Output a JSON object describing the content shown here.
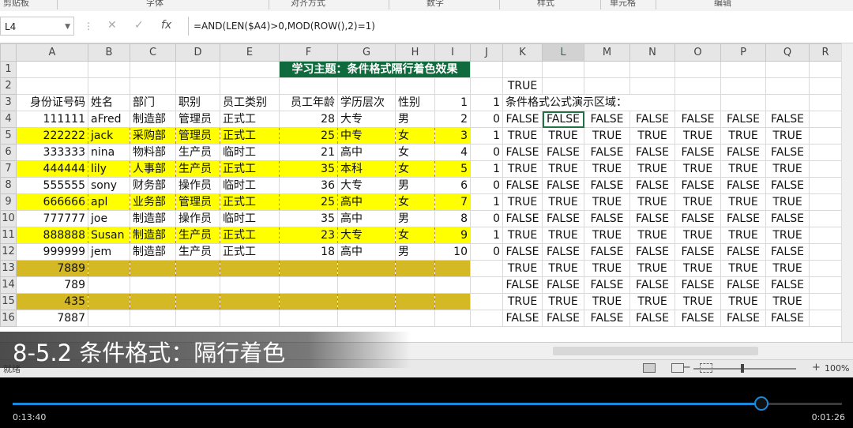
{
  "ribbon": {
    "groups": [
      "剪贴板",
      "字体",
      "对齐方式",
      "数字",
      "样式",
      "单元格",
      "编辑"
    ]
  },
  "formula_bar": {
    "name_box": "L4",
    "formula": "=AND(LEN($A4)>0,MOD(ROW(),2)=1)"
  },
  "columns": [
    "A",
    "B",
    "C",
    "D",
    "E",
    "F",
    "G",
    "H",
    "I",
    "J",
    "K",
    "L",
    "M",
    "N",
    "O",
    "P",
    "Q",
    "R"
  ],
  "selected_column": "L",
  "rows": [
    {
      "num": "1",
      "cells": [
        "",
        "",
        "",
        "",
        "",
        "学习主题：条件格式隔行着色效果",
        "",
        "",
        "",
        "",
        "",
        "",
        "",
        "",
        "",
        "",
        "",
        ""
      ]
    },
    {
      "num": "2",
      "cells": [
        "",
        "",
        "",
        "",
        "",
        "",
        "",
        "",
        "",
        "",
        "TRUE",
        "",
        "",
        "",
        "",
        "",
        "",
        ""
      ]
    },
    {
      "num": "3",
      "cells": [
        "身份证号码",
        "姓名",
        "部门",
        "职别",
        "员工类别",
        "员工年龄",
        "学历层次",
        "性别",
        "1",
        "1",
        "条件格式公式演示区域：",
        "",
        "",
        "",
        "",
        "",
        "",
        ""
      ]
    },
    {
      "num": "4",
      "cells": [
        "111111",
        "aFred",
        "制造部",
        "管理员",
        "正式工",
        "28",
        "大专",
        "男",
        "2",
        "0",
        "FALSE",
        "FALSE",
        "FALSE",
        "FALSE",
        "FALSE",
        "FALSE",
        "FALSE",
        ""
      ]
    },
    {
      "num": "5",
      "cells": [
        "222222",
        "jack",
        "采购部",
        "管理员",
        "正式工",
        "25",
        "中专",
        "女",
        "3",
        "1",
        "TRUE",
        "TRUE",
        "TRUE",
        "TRUE",
        "TRUE",
        "TRUE",
        "TRUE",
        ""
      ]
    },
    {
      "num": "6",
      "cells": [
        "333333",
        "nina",
        "物料部",
        "生产员",
        "临时工",
        "21",
        "高中",
        "女",
        "4",
        "0",
        "FALSE",
        "FALSE",
        "FALSE",
        "FALSE",
        "FALSE",
        "FALSE",
        "FALSE",
        ""
      ]
    },
    {
      "num": "7",
      "cells": [
        "444444",
        "lily",
        "人事部",
        "生产员",
        "正式工",
        "35",
        "本科",
        "女",
        "5",
        "1",
        "TRUE",
        "TRUE",
        "TRUE",
        "TRUE",
        "TRUE",
        "TRUE",
        "TRUE",
        ""
      ]
    },
    {
      "num": "8",
      "cells": [
        "555555",
        "sony",
        "财务部",
        "操作员",
        "临时工",
        "36",
        "大专",
        "男",
        "6",
        "0",
        "FALSE",
        "FALSE",
        "FALSE",
        "FALSE",
        "FALSE",
        "FALSE",
        "FALSE",
        ""
      ]
    },
    {
      "num": "9",
      "cells": [
        "666666",
        "apl",
        "业务部",
        "管理员",
        "正式工",
        "25",
        "高中",
        "女",
        "7",
        "1",
        "TRUE",
        "TRUE",
        "TRUE",
        "TRUE",
        "TRUE",
        "TRUE",
        "TRUE",
        ""
      ]
    },
    {
      "num": "10",
      "cells": [
        "777777",
        "joe",
        "制造部",
        "操作员",
        "临时工",
        "35",
        "高中",
        "男",
        "8",
        "0",
        "FALSE",
        "FALSE",
        "FALSE",
        "FALSE",
        "FALSE",
        "FALSE",
        "FALSE",
        ""
      ]
    },
    {
      "num": "11",
      "cells": [
        "888888",
        "Susan",
        "制造部",
        "生产员",
        "正式工",
        "23",
        "大专",
        "女",
        "9",
        "1",
        "TRUE",
        "TRUE",
        "TRUE",
        "TRUE",
        "TRUE",
        "TRUE",
        "TRUE",
        ""
      ]
    },
    {
      "num": "12",
      "cells": [
        "999999",
        "jem",
        "制造部",
        "生产员",
        "正式工",
        "18",
        "高中",
        "男",
        "10",
        "0",
        "FALSE",
        "FALSE",
        "FALSE",
        "FALSE",
        "FALSE",
        "FALSE",
        "FALSE",
        ""
      ]
    },
    {
      "num": "13",
      "cells": [
        "7889",
        "",
        "",
        "",
        "",
        "",
        "",
        "",
        "",
        "",
        "TRUE",
        "TRUE",
        "TRUE",
        "TRUE",
        "TRUE",
        "TRUE",
        "TRUE",
        ""
      ]
    },
    {
      "num": "14",
      "cells": [
        "789",
        "",
        "",
        "",
        "",
        "",
        "",
        "",
        "",
        "",
        "FALSE",
        "FALSE",
        "FALSE",
        "FALSE",
        "FALSE",
        "FALSE",
        "FALSE",
        ""
      ]
    },
    {
      "num": "15",
      "cells": [
        "435",
        "",
        "",
        "",
        "",
        "",
        "",
        "",
        "",
        "",
        "TRUE",
        "TRUE",
        "TRUE",
        "TRUE",
        "TRUE",
        "TRUE",
        "TRUE",
        ""
      ]
    },
    {
      "num": "16",
      "cells": [
        "7887",
        "",
        "",
        "",
        "",
        "",
        "",
        "",
        "",
        "",
        "FALSE",
        "FALSE",
        "FALSE",
        "FALSE",
        "FALSE",
        "FALSE",
        "FALSE",
        ""
      ]
    }
  ],
  "highlight_color": "#ffff00",
  "title_color": "#0f6b3d",
  "status": {
    "ready": "就绪",
    "zoom": "100%"
  },
  "caption": "8-5.2 条件格式：隔行着色",
  "player": {
    "elapsed": "0:13:40",
    "remaining": "0:01:26",
    "progress": 0.903
  }
}
